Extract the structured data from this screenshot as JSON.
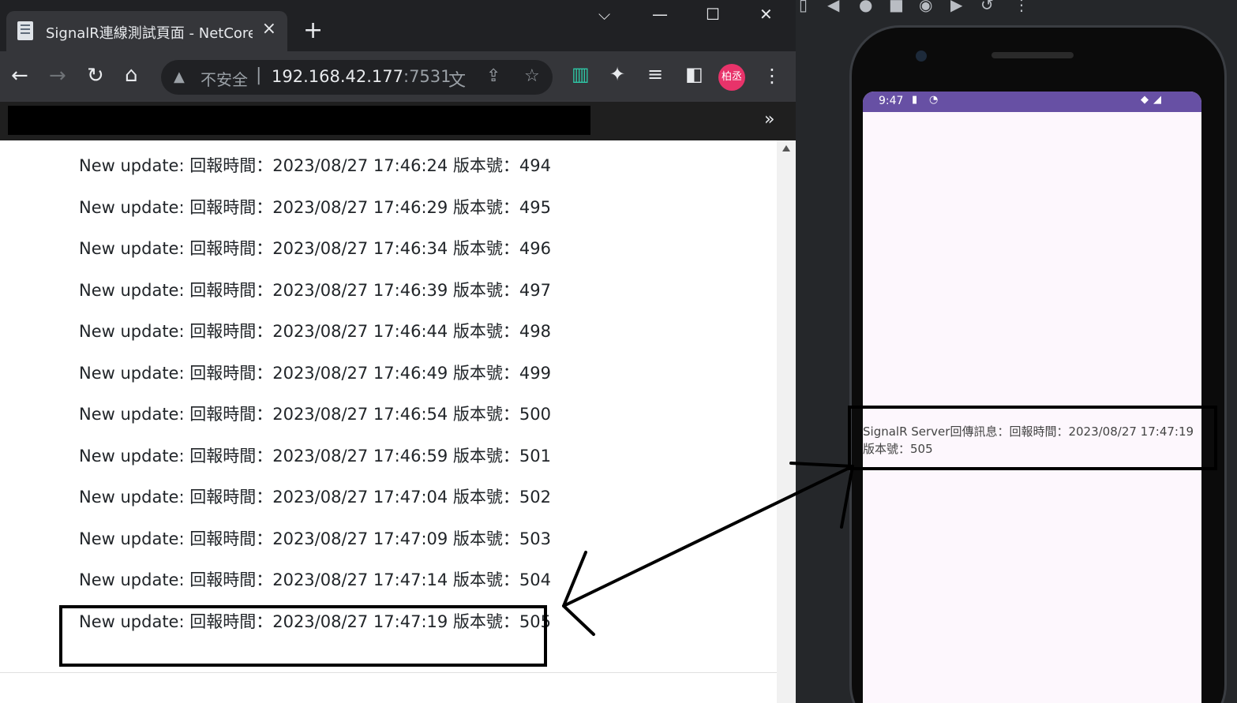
{
  "browser": {
    "tab": {
      "title": "SignalR連線測試頁面 - NetCore",
      "close_icon": "×"
    },
    "new_tab_icon": "+",
    "window_controls": {
      "tabsearch": "⌵",
      "minimize": "—",
      "maximize": "☐",
      "close": "✕"
    },
    "toolbar": {
      "back": "←",
      "forward": "→",
      "reload": "↻",
      "home": "⌂",
      "security_label": "不安全",
      "separator": "|",
      "host": "192.168.42.177",
      "port": ":7531",
      "translate_icon": "文",
      "share_icon": "⇪",
      "star_icon": "☆",
      "ext_icon_1": "▥",
      "extensions_icon": "✦",
      "media_icon": "≡",
      "sidepanel_icon": "◧",
      "avatar_label": "柏丞",
      "menu_icon": "⋮"
    },
    "bookmarks_more": "»",
    "messages": [
      "New update: 回報時間：2023/08/27 17:46:24 版本號：494",
      "New update: 回報時間：2023/08/27 17:46:29 版本號：495",
      "New update: 回報時間：2023/08/27 17:46:34 版本號：496",
      "New update: 回報時間：2023/08/27 17:46:39 版本號：497",
      "New update: 回報時間：2023/08/27 17:46:44 版本號：498",
      "New update: 回報時間：2023/08/27 17:46:49 版本號：499",
      "New update: 回報時間：2023/08/27 17:46:54 版本號：500",
      "New update: 回報時間：2023/08/27 17:46:59 版本號：501",
      "New update: 回報時間：2023/08/27 17:47:04 版本號：502",
      "New update: 回報時間：2023/08/27 17:47:09 版本號：503",
      "New update: 回報時間：2023/08/27 17:47:14 版本號：504",
      "New update: 回報時間：2023/08/27 17:47:19 版本號：505"
    ]
  },
  "emulator": {
    "toolbar_icons": [
      "▯",
      "◀",
      "●",
      "■",
      "◉",
      "▶",
      "↺",
      "⋮"
    ],
    "status": {
      "time": "9:47",
      "sd_icon": "▮",
      "sync_icon": "◔",
      "wifi_icon": "◆",
      "signal_icon": "◢"
    },
    "app_message": "SignalR Server回傳訊息：回報時間：2023/08/27 17:47:19 版本號：505"
  },
  "colors": {
    "status_bar": "#6750a4",
    "avatar": "#e8336a",
    "screen_bg": "#fdf7fd"
  }
}
